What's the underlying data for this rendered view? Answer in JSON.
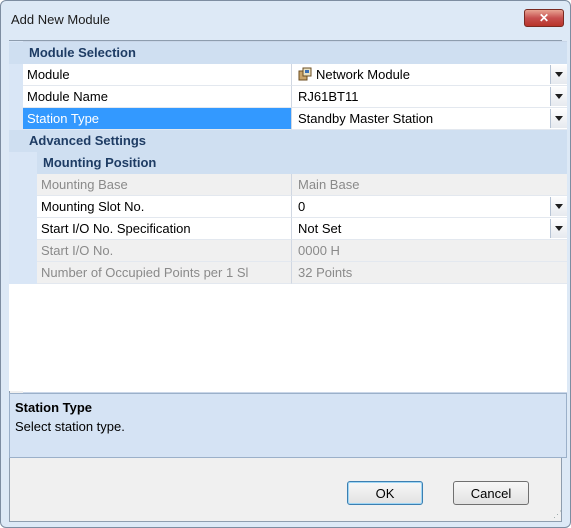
{
  "window": {
    "title": "Add New Module",
    "close_glyph": "✕"
  },
  "sections": {
    "module_selection": "Module Selection",
    "advanced_settings": "Advanced Settings",
    "mounting_position": "Mounting Position"
  },
  "rows": {
    "module": {
      "name": "Module",
      "value": "Network Module",
      "icon": "network-module-icon"
    },
    "module_name": {
      "name": "Module Name",
      "value": "RJ61BT11"
    },
    "station_type": {
      "name": "Station Type",
      "value": "Standby Master Station"
    },
    "mounting_base": {
      "name": "Mounting Base",
      "value": "Main Base"
    },
    "mounting_slot": {
      "name": "Mounting Slot No.",
      "value": "0"
    },
    "start_io_spec": {
      "name": "Start I/O No. Specification",
      "value": "Not Set"
    },
    "start_io": {
      "name": "Start I/O No.",
      "value": "0000 H"
    },
    "occupied_points": {
      "name": "Number of Occupied Points per 1 Sl",
      "value": "32 Points"
    }
  },
  "help": {
    "title": "Station Type",
    "description": "Select station type."
  },
  "buttons": {
    "ok": "OK",
    "cancel": "Cancel"
  },
  "colors": {
    "selection": "#3399ff",
    "category_bg": "#cfdff1",
    "category_text": "#1e3c64"
  }
}
